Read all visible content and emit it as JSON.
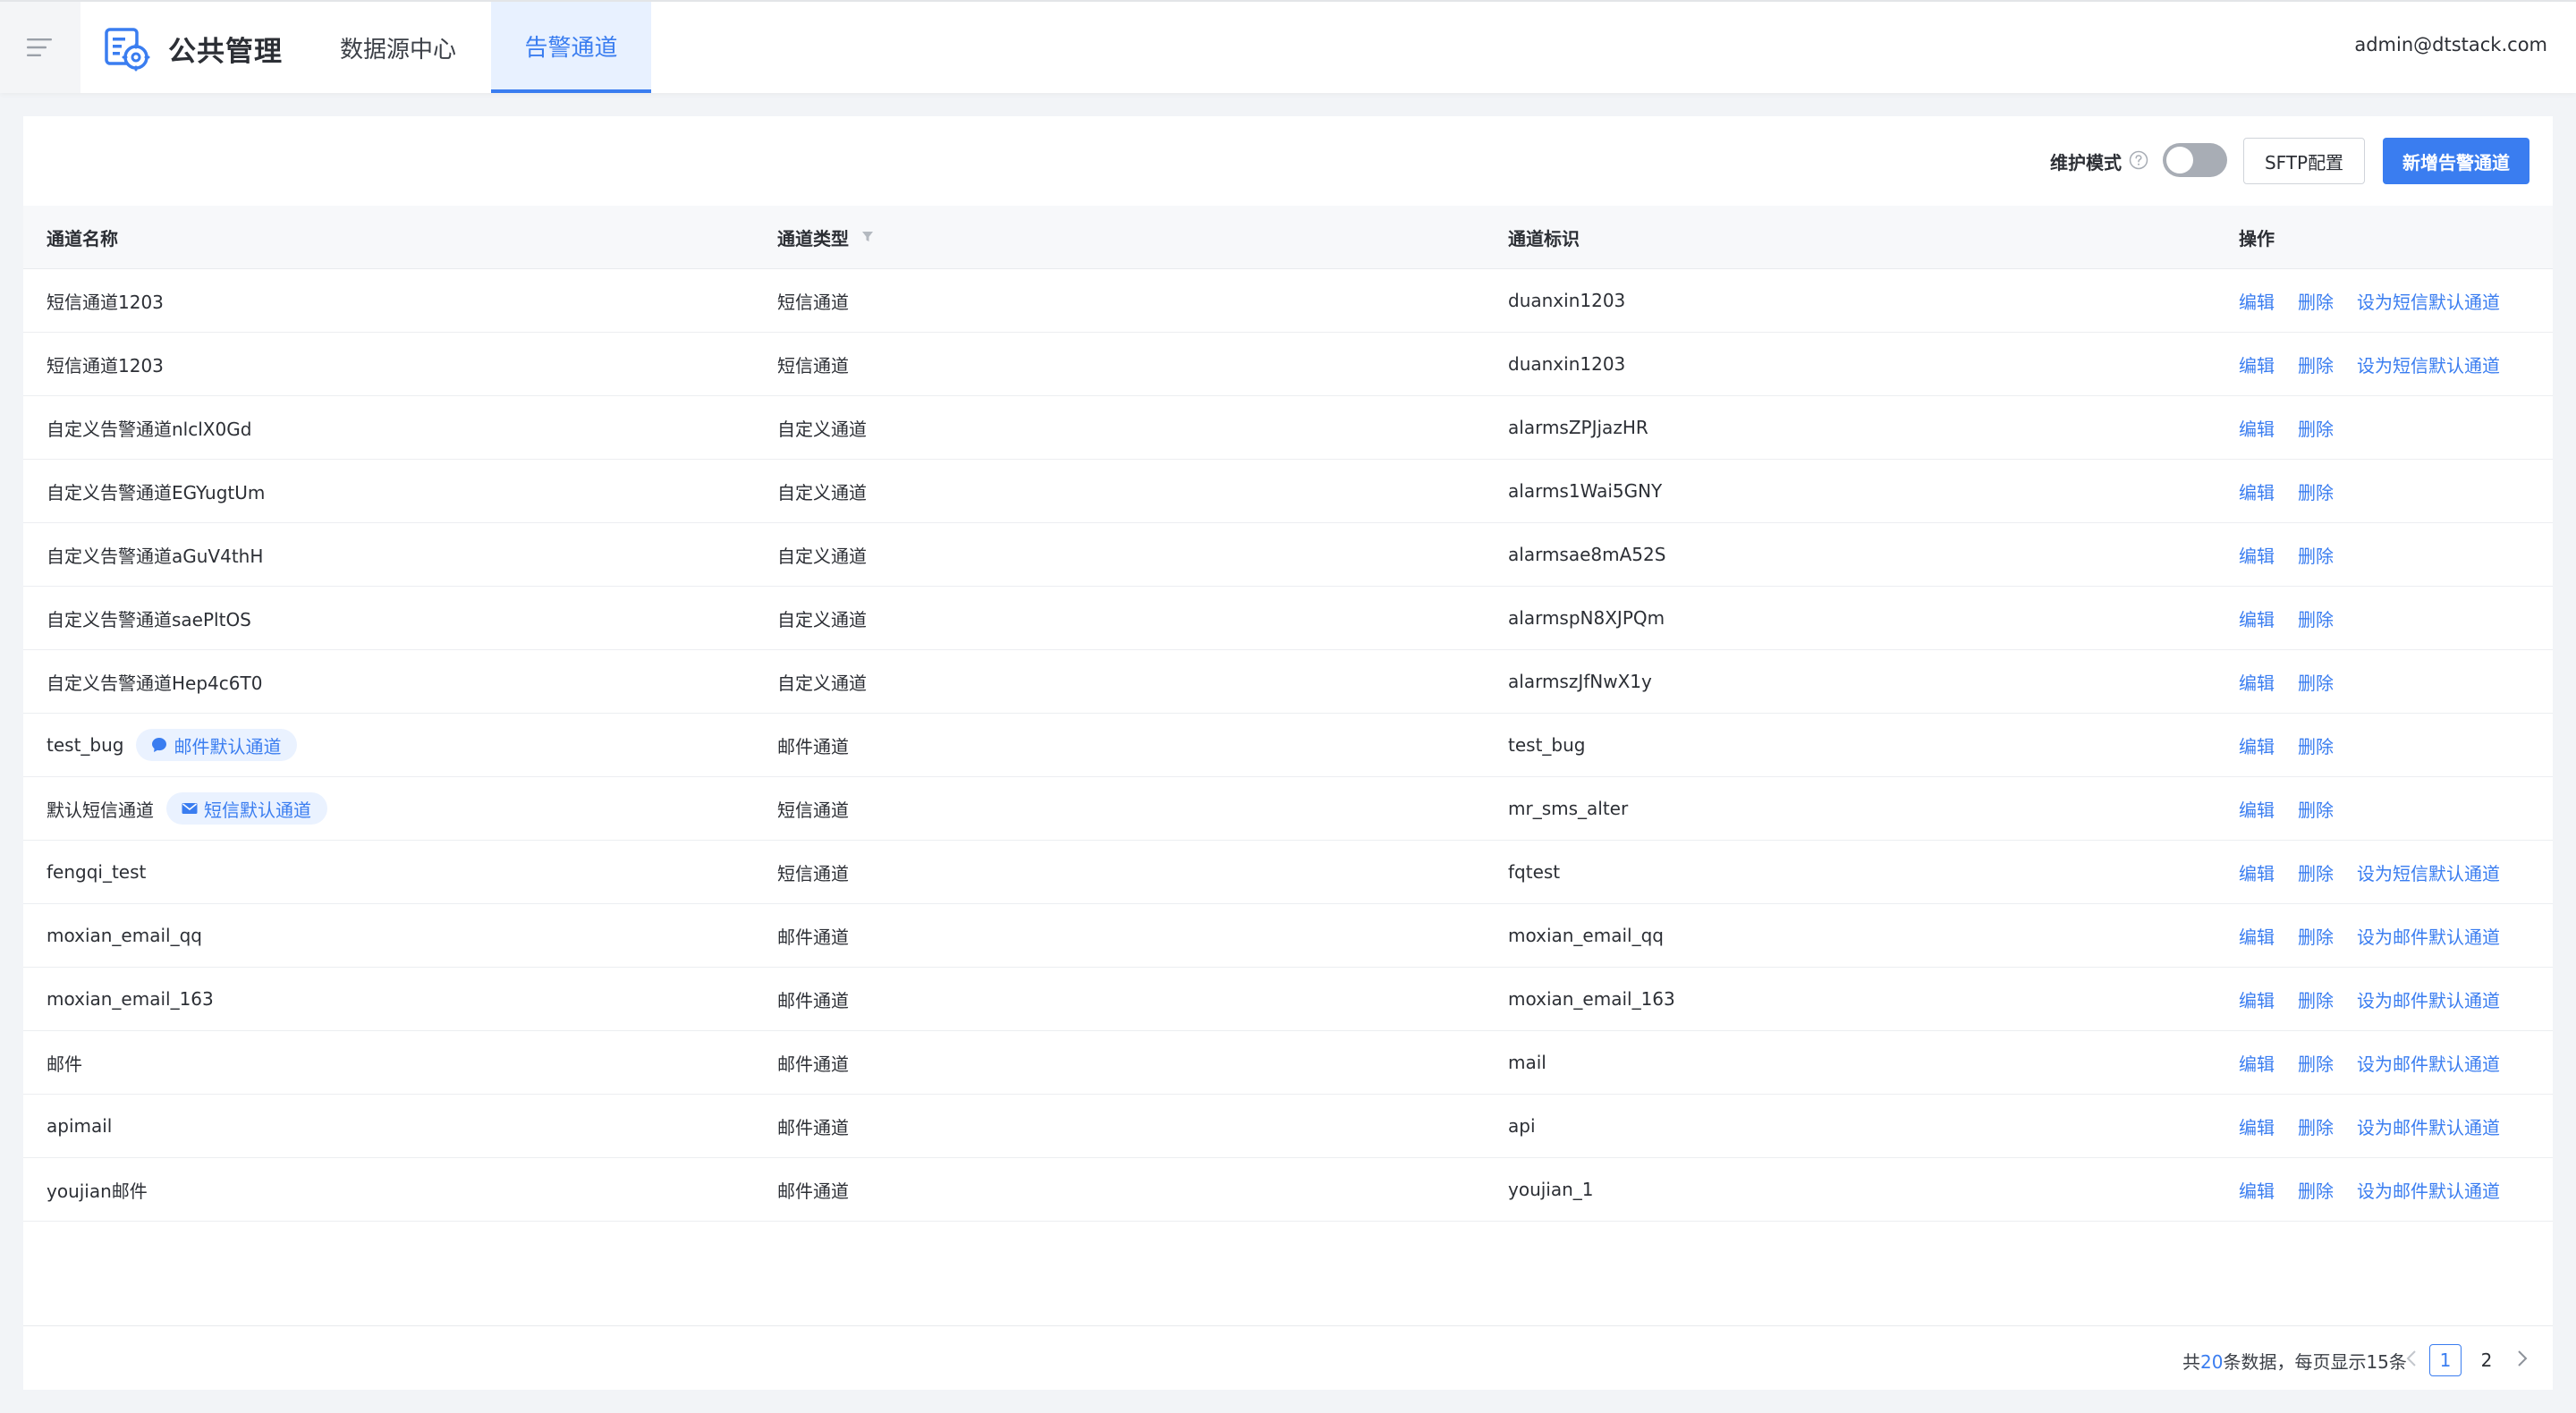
{
  "header": {
    "brand_title": "公共管理",
    "tabs": [
      {
        "label": "数据源中心",
        "active": false
      },
      {
        "label": "告警通道",
        "active": true
      }
    ],
    "user_email": "admin@dtstack.com"
  },
  "toolbar": {
    "maintenance_label": "维护模式",
    "maintenance_on": false,
    "sftp_button": "SFTP配置",
    "add_button": "新增告警通道"
  },
  "table": {
    "columns": [
      "通道名称",
      "通道类型",
      "通道标识",
      "操作"
    ],
    "rows": [
      {
        "name": "短信通道1203",
        "badge": "",
        "type": "短信通道",
        "id": "duanxin1203",
        "actions": [
          "编辑",
          "删除",
          "设为短信默认通道"
        ]
      },
      {
        "name": "短信通道1203",
        "badge": "",
        "type": "短信通道",
        "id": "duanxin1203",
        "actions": [
          "编辑",
          "删除",
          "设为短信默认通道"
        ]
      },
      {
        "name": "自定义告警通道nlclX0Gd",
        "badge": "",
        "type": "自定义通道",
        "id": "alarmsZPJjazHR",
        "actions": [
          "编辑",
          "删除"
        ]
      },
      {
        "name": "自定义告警通道EGYugtUm",
        "badge": "",
        "type": "自定义通道",
        "id": "alarms1Wai5GNY",
        "actions": [
          "编辑",
          "删除"
        ]
      },
      {
        "name": "自定义告警通道aGuV4thH",
        "badge": "",
        "type": "自定义通道",
        "id": "alarmsae8mA52S",
        "actions": [
          "编辑",
          "删除"
        ]
      },
      {
        "name": "自定义告警通道saePltOS",
        "badge": "",
        "type": "自定义通道",
        "id": "alarmspN8XJPQm",
        "actions": [
          "编辑",
          "删除"
        ]
      },
      {
        "name": "自定义告警通道Hep4c6T0",
        "badge": "",
        "type": "自定义通道",
        "id": "alarmszJfNwX1y",
        "actions": [
          "编辑",
          "删除"
        ]
      },
      {
        "name": "test_bug",
        "badge": "邮件默认通道",
        "badge_icon": "chat-bubble-icon",
        "type": "邮件通道",
        "id": "test_bug",
        "actions": [
          "编辑",
          "删除"
        ]
      },
      {
        "name": "默认短信通道",
        "badge": "短信默认通道",
        "badge_icon": "envelope-icon",
        "type": "短信通道",
        "id": "mr_sms_alter",
        "actions": [
          "编辑",
          "删除"
        ]
      },
      {
        "name": "fengqi_test",
        "badge": "",
        "type": "短信通道",
        "id": "fqtest",
        "actions": [
          "编辑",
          "删除",
          "设为短信默认通道"
        ]
      },
      {
        "name": "moxian_email_qq",
        "badge": "",
        "type": "邮件通道",
        "id": "moxian_email_qq",
        "actions": [
          "编辑",
          "删除",
          "设为邮件默认通道"
        ]
      },
      {
        "name": "moxian_email_163",
        "badge": "",
        "type": "邮件通道",
        "id": "moxian_email_163",
        "actions": [
          "编辑",
          "删除",
          "设为邮件默认通道"
        ]
      },
      {
        "name": "邮件",
        "badge": "",
        "type": "邮件通道",
        "id": "mail",
        "actions": [
          "编辑",
          "删除",
          "设为邮件默认通道"
        ]
      },
      {
        "name": "apimail",
        "badge": "",
        "type": "邮件通道",
        "id": "api",
        "actions": [
          "编辑",
          "删除",
          "设为邮件默认通道"
        ]
      },
      {
        "name": "youjian邮件",
        "badge": "",
        "type": "邮件通道",
        "id": "youjian_1",
        "actions": [
          "编辑",
          "删除",
          "设为邮件默认通道"
        ]
      }
    ]
  },
  "pagination": {
    "total_prefix": "共",
    "total_count": "20",
    "total_suffix": "条数据，每页显示15条",
    "pages": [
      "1",
      "2"
    ],
    "current_page": "1"
  },
  "colors": {
    "accent": "#3a7df0",
    "tab_active_bg": "#e8f1ff",
    "badge_bg": "#eaf2ff",
    "toggle_off": "#a8adb5"
  }
}
